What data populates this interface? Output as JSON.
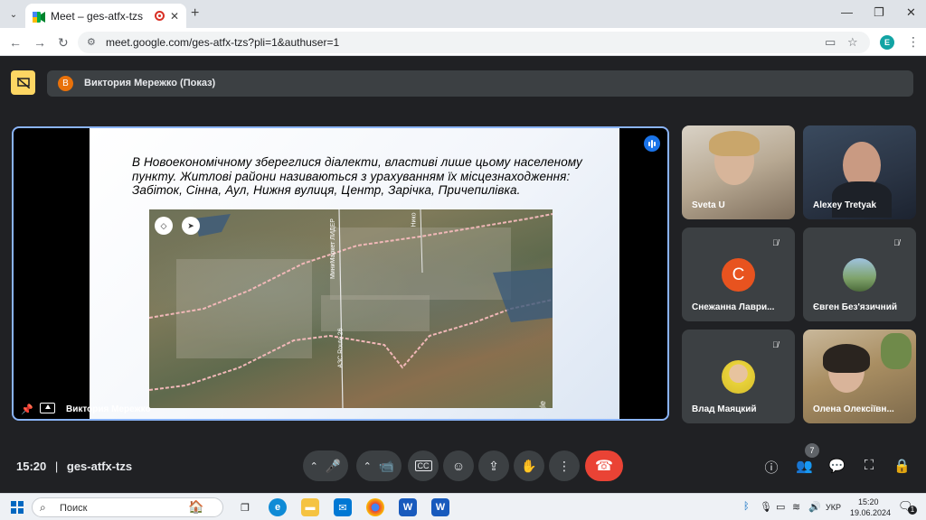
{
  "browser": {
    "tab_title": "Meet – ges-atfx-tzs",
    "new_tab": "+",
    "url": "meet.google.com/ges-atfx-tzs?pli=1&authuser=1",
    "profile_initial": "E",
    "window_controls": {
      "minimize": "—",
      "restore": "❐",
      "close": "✕"
    }
  },
  "presenter_bar": {
    "avatar_initial": "В",
    "text": "Виктория Мережко (Показ)"
  },
  "stage": {
    "presenter_name": "Виктория Мережко",
    "slide_text": "В Новоекономічному збереглися діалекти, властиві лише цьому населеному пункту. Житлові райони називаються з урахуванням їх місцезнаходження: Забіток, Сінна, Аул, Нижня вулиця, Центр, Зарічка, Причепилівка.",
    "map_labels": {
      "road1": "АЗС Route 26",
      "road2": "МиниМаркет ЛИДЕР",
      "road3": "Нико",
      "google": "Google"
    }
  },
  "participants": [
    {
      "name": "Sveta U",
      "muted": false,
      "type": "camera"
    },
    {
      "name": "Alexey Tretyak",
      "muted": false,
      "type": "camera"
    },
    {
      "name": "Снежанна Лаври...",
      "muted": true,
      "type": "initial",
      "initial": "С",
      "color": "#e8531f"
    },
    {
      "name": "Євген Без'язичний",
      "muted": true,
      "type": "photo"
    },
    {
      "name": "Влад Маяцкий",
      "muted": true,
      "type": "photo"
    },
    {
      "name": "Олена Олексіївн...",
      "muted": false,
      "type": "camera"
    }
  ],
  "controls": {
    "time": "15:20",
    "separator": "|",
    "meeting_code": "ges-atfx-tzs",
    "people_count": "7"
  },
  "taskbar": {
    "search_placeholder": "Поиск",
    "language": "УКР",
    "time": "15:20",
    "date": "19.06.2024",
    "notifications": "1"
  },
  "colors": {
    "meet_bg": "#202124",
    "tile_bg": "#3c4043",
    "active_border": "#8ab4f8",
    "end_call": "#ea4335",
    "banner_accent": "#fdd663"
  }
}
